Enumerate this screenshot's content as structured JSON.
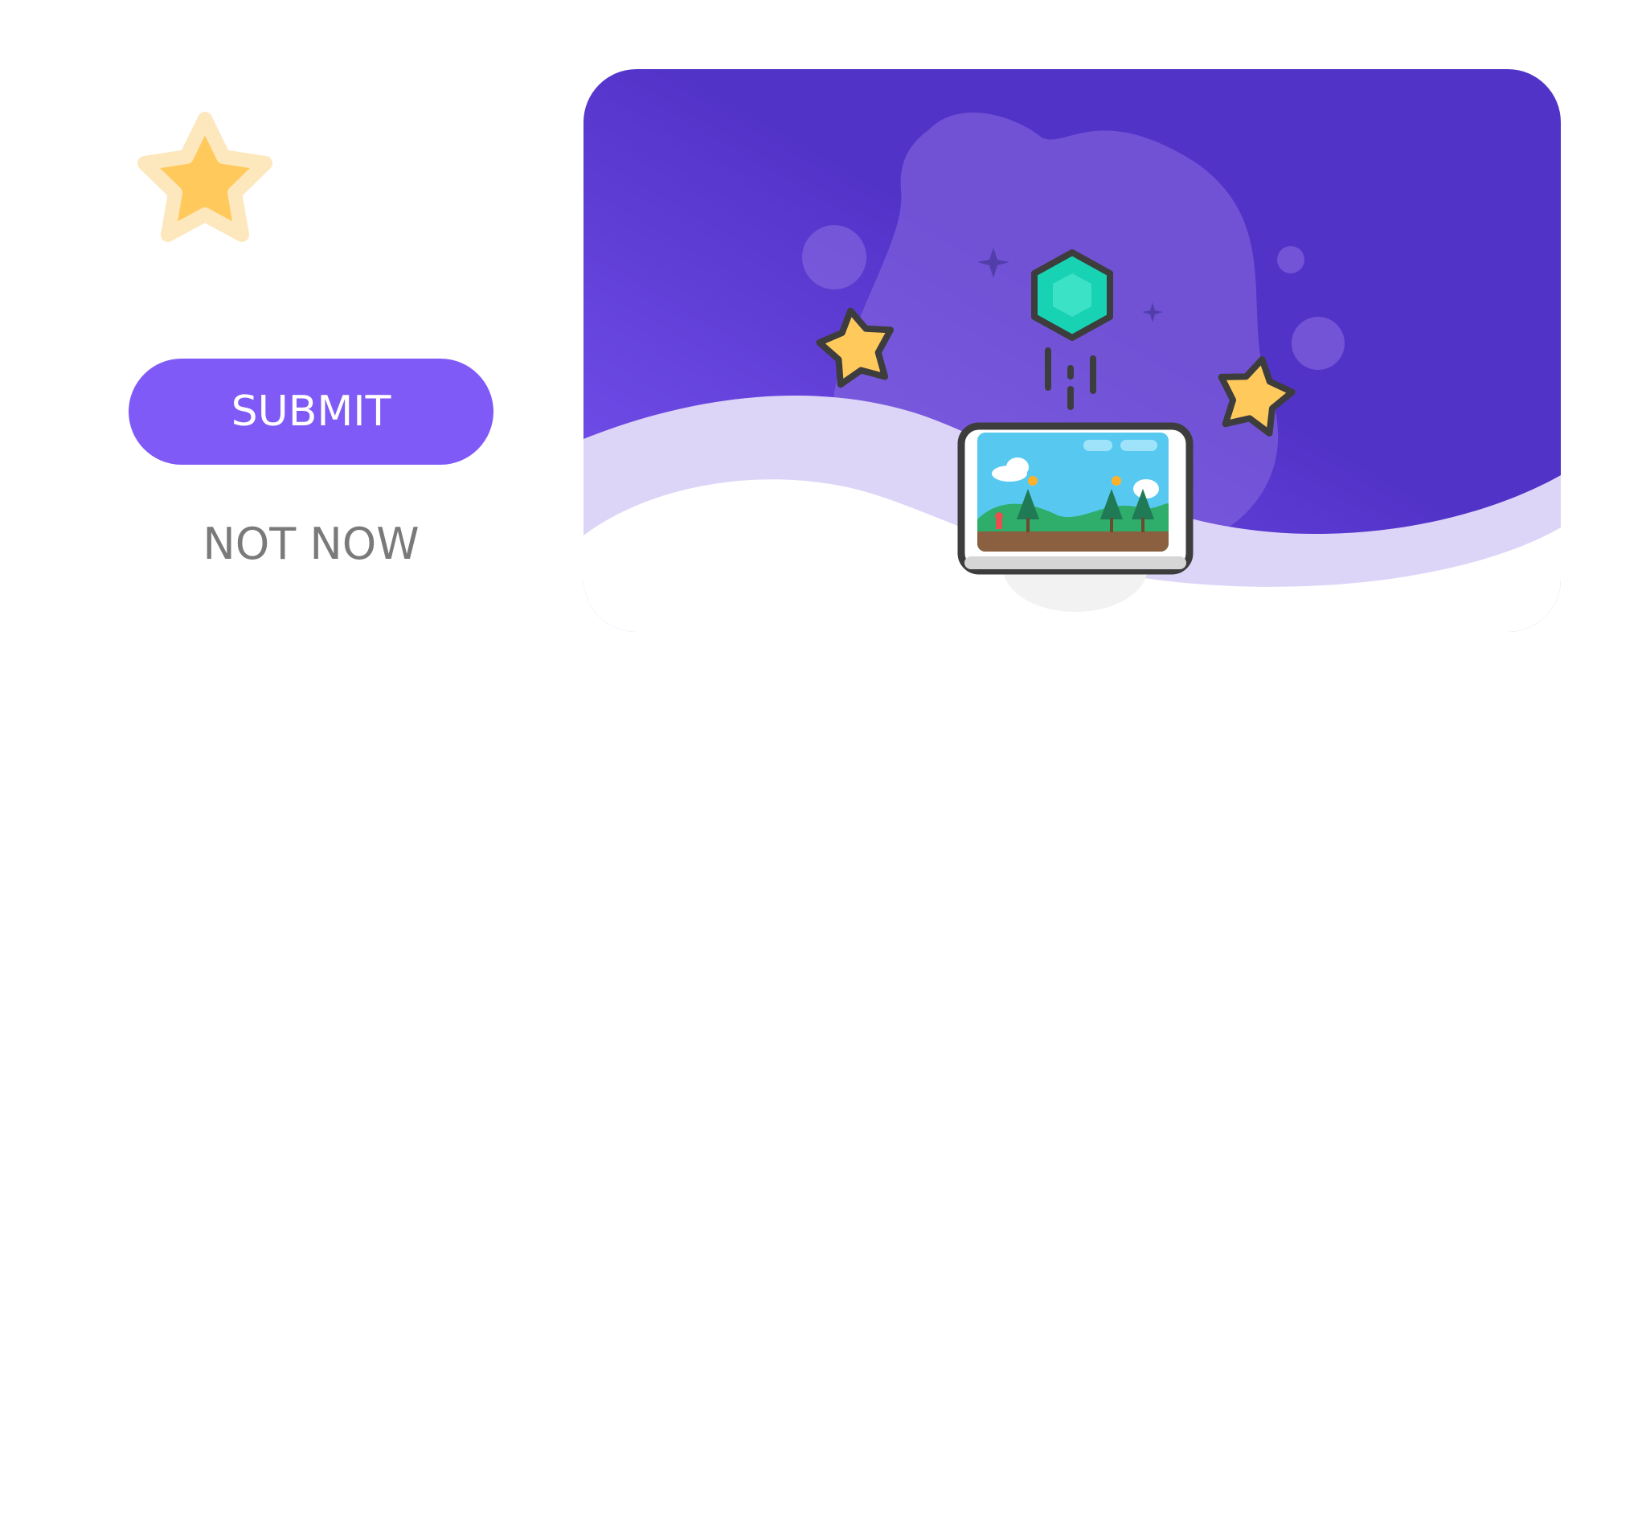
{
  "actions": {
    "submit_label": "SUBMIT",
    "not_now_label": "NOT NOW"
  },
  "rating": {
    "icon": "star-icon"
  },
  "hero": {
    "illustration": "game-tablet-illustration",
    "colors": {
      "panel_dark": "#5233c8",
      "panel_light": "#7b55f3",
      "wave": "#ddd5f8",
      "star": "#ffc95c",
      "gem": "#17d3b3"
    }
  },
  "colors": {
    "accent": "#7f5af7",
    "muted_text": "#7a7a7a"
  }
}
